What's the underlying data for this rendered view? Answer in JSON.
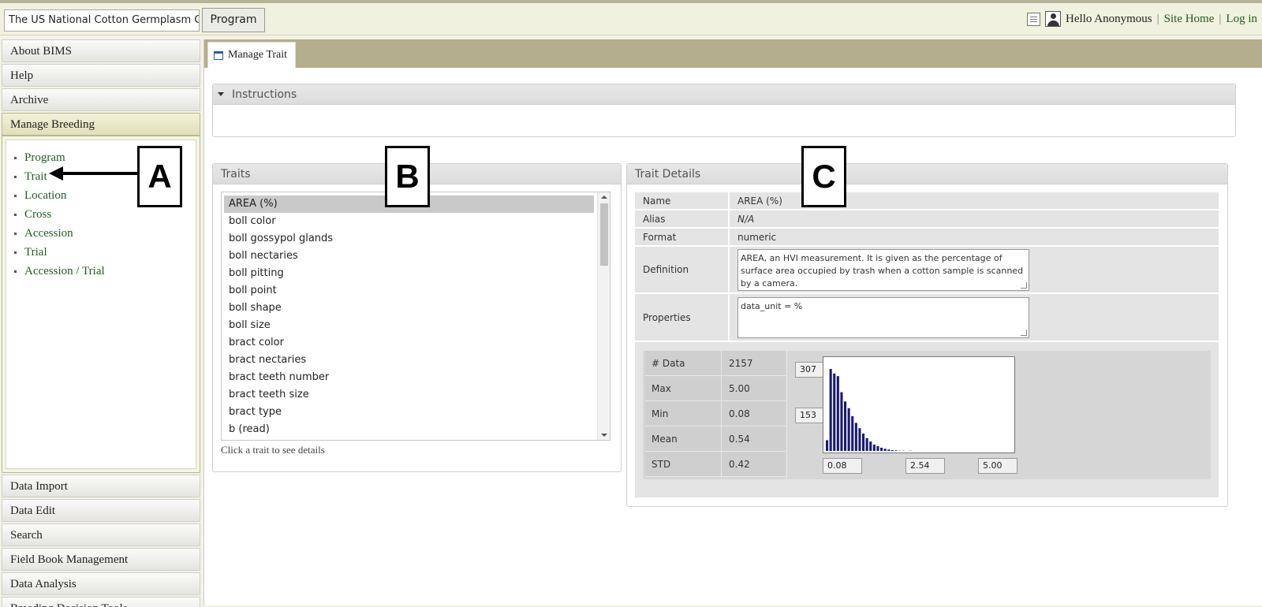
{
  "topbar": {
    "site_name": "The US National Cotton Germplasm Co",
    "program_label": "Program",
    "greeting": "Hello Anonymous",
    "separator": "|",
    "site_home": "Site Home",
    "log_in": "Log in"
  },
  "sidebar": {
    "top_items": [
      {
        "label": "About BIMS"
      },
      {
        "label": "Help"
      },
      {
        "label": "Archive"
      }
    ],
    "active_section": "Manage Breeding",
    "links": [
      {
        "label": "Program"
      },
      {
        "label": "Trait"
      },
      {
        "label": "Location"
      },
      {
        "label": "Cross"
      },
      {
        "label": "Accession"
      },
      {
        "label": "Trial"
      },
      {
        "label": "Accession / Trial"
      }
    ],
    "bottom_items": [
      {
        "label": "Data Import"
      },
      {
        "label": "Data Edit"
      },
      {
        "label": "Search"
      },
      {
        "label": "Field Book Management"
      },
      {
        "label": "Data Analysis"
      },
      {
        "label": "Breeding Decision Tools"
      }
    ]
  },
  "main": {
    "tab_label": "Manage Trait",
    "instructions_title": "Instructions",
    "traits": {
      "title": "Traits",
      "items": [
        "AREA (%)",
        "boll color",
        "boll gossypol glands",
        "boll nectaries",
        "boll pitting",
        "boll point",
        "boll shape",
        "boll size",
        "bract color",
        "bract nectaries",
        "bract teeth number",
        "bract teeth size",
        "bract type",
        "b (read)"
      ],
      "selected_index": 0,
      "hint": "Click a trait to see details"
    },
    "details": {
      "title": "Trait Details",
      "name_label": "Name",
      "name_value": "AREA (%)",
      "alias_label": "Alias",
      "alias_value": "N/A",
      "format_label": "Format",
      "format_value": "numeric",
      "definition_label": "Definition",
      "definition_value": "AREA, an HVI measurement. It is given as the percentage of surface area occupied by trash when a cotton sample is scanned by a camera.",
      "properties_label": "Properties",
      "properties_value": "data_unit = %",
      "stats": [
        {
          "label": "# Data",
          "value": "2157"
        },
        {
          "label": "Max",
          "value": "5.00"
        },
        {
          "label": "Min",
          "value": "0.08"
        },
        {
          "label": "Mean",
          "value": "0.54"
        },
        {
          "label": "STD",
          "value": "0.42"
        }
      ],
      "histogram": {
        "y_top": "307",
        "y_mid": "153",
        "x_min": "0.08",
        "x_mid": "2.54",
        "x_max": "5.00",
        "bar_color": "#1a1a6e",
        "counts": [
          40,
          307,
          290,
          280,
          220,
          185,
          160,
          130,
          105,
          85,
          65,
          48,
          35,
          24,
          18,
          12,
          8,
          5,
          3,
          2,
          1,
          1,
          0,
          1,
          0,
          0
        ]
      }
    }
  },
  "annotations": {
    "a": "A",
    "b": "B",
    "c": "C"
  }
}
